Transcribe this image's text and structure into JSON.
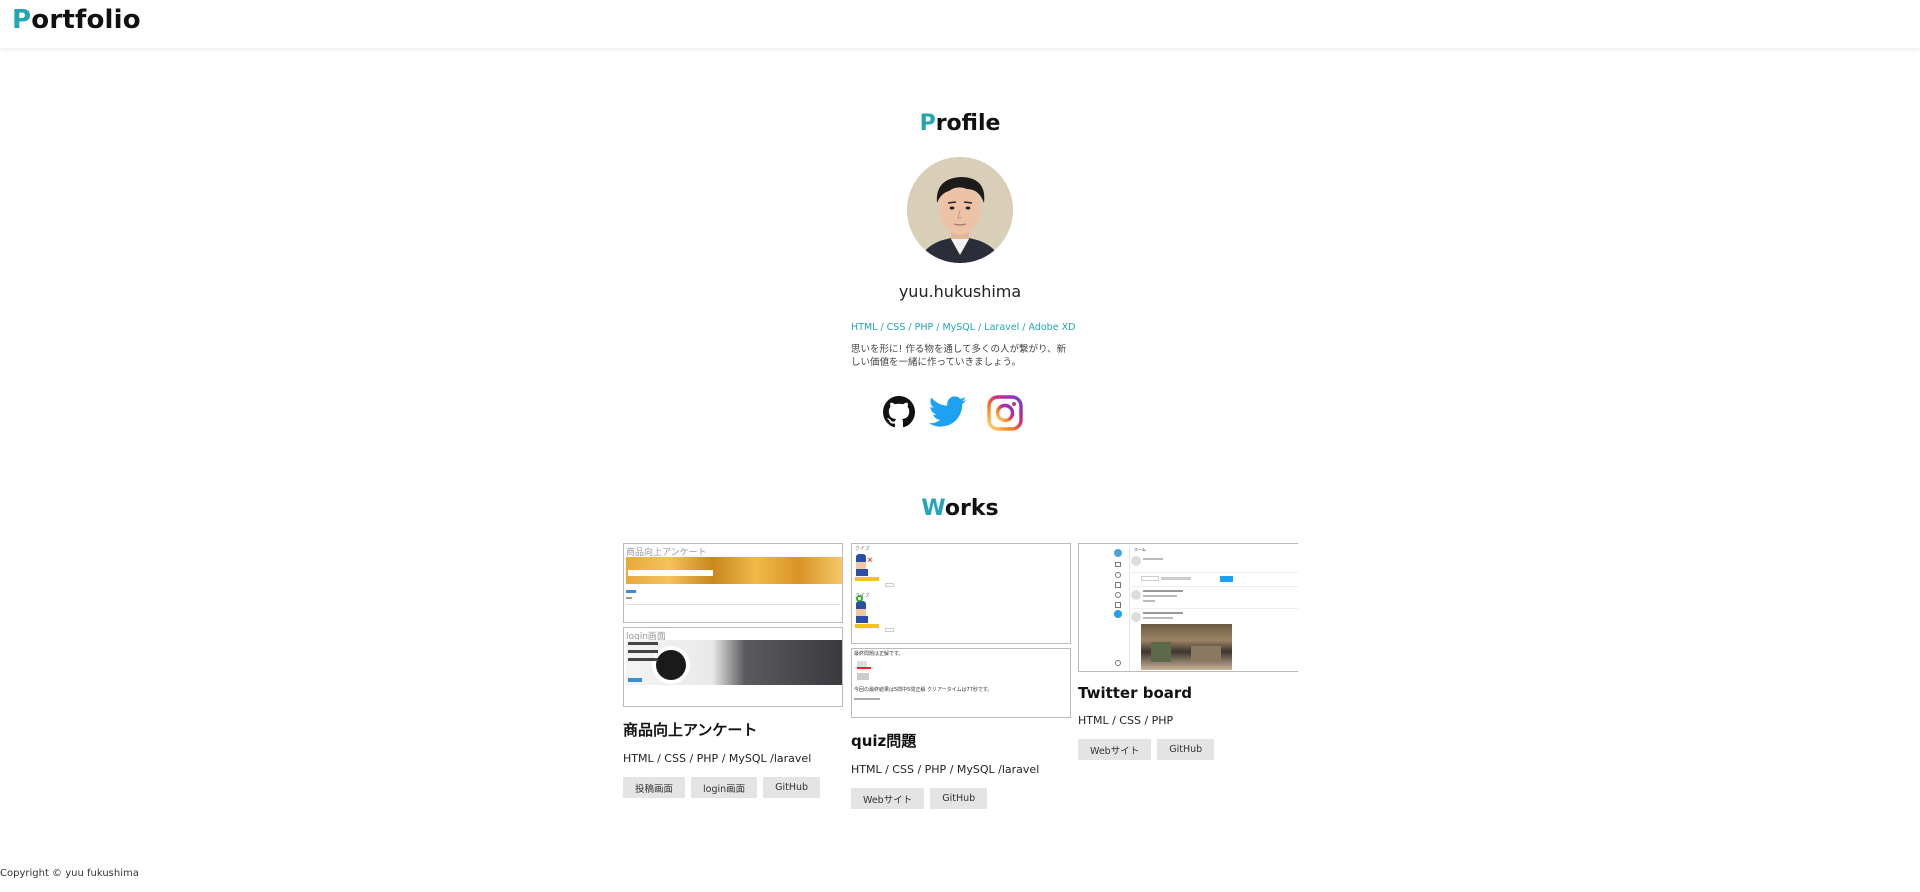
{
  "header": {
    "logo_first": "P",
    "logo_rest": "ortfolio"
  },
  "profile": {
    "title_first": "P",
    "title_rest": "rofile",
    "name": "yuu.hukushima",
    "skills": "HTML / CSS / PHP / MySQL / Laravel / Adobe XD",
    "bio": "思いを形に! 作る物を通して多くの人が繋がり、新しい価値を一緒に作っていきましょう。",
    "social_icons": [
      "github-icon",
      "twitter-icon",
      "instagram-icon"
    ]
  },
  "works": {
    "title_first": "W",
    "title_rest": "orks",
    "items": [
      {
        "title": "商品向上アンケート",
        "tech": "HTML / CSS / PHP / MySQL /laravel",
        "thumb_labels": [
          "商品向上アンケート",
          "login画面"
        ],
        "buttons": [
          "投稿画面",
          "login画面",
          "GitHub"
        ]
      },
      {
        "title": "quiz問題",
        "tech": "HTML / CSS / PHP / MySQL /laravel",
        "thumb_labels": [
          "最終問題は正解です。",
          "今回の最終結果は5問中5問正解 クリアータイムは77秒です。"
        ],
        "buttons": [
          "Webサイト",
          "GitHub"
        ]
      },
      {
        "title": "Twitter board",
        "tech": "HTML / CSS / PHP",
        "thumb_labels": [],
        "buttons": [
          "Webサイト",
          "GitHub"
        ]
      }
    ]
  },
  "footer": {
    "copyright": "Copyright © yuu fukushima"
  },
  "colors": {
    "accent": "#22a6b3",
    "twitter": "#1da1f2",
    "button_bg": "#e4e4e4"
  }
}
